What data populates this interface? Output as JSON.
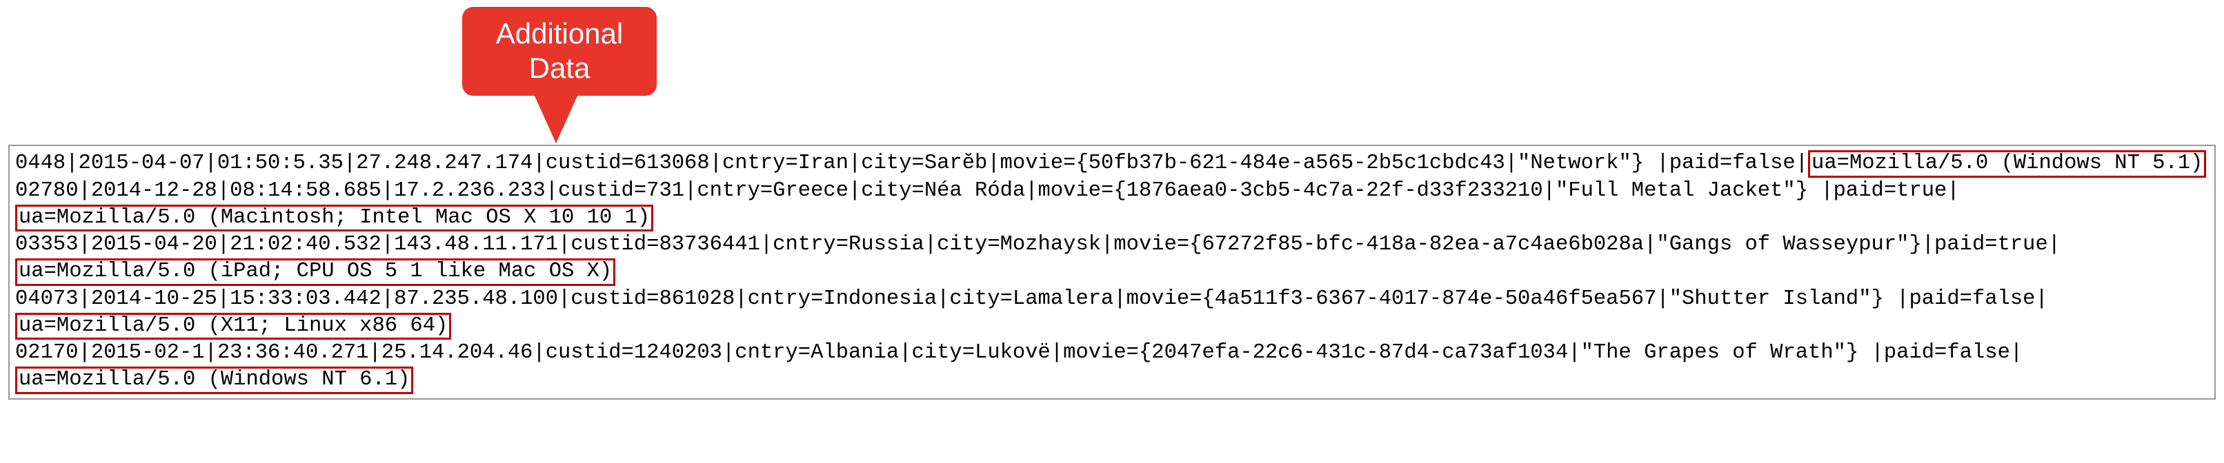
{
  "callout": {
    "line1": "Additional",
    "line2": "Data"
  },
  "log": {
    "entries": [
      {
        "prefix": "0448|2015-04-07|01:50:5.35|27.248.247.174|custid=613068|cntry=Iran|city=Sarĕb|movie={50fb37b-621-484e-a565-2b5c1cbdc43|\"Network\"} |paid=false|",
        "highlight": "ua=Mozilla/5.0 (Windows NT 5.1)"
      },
      {
        "prefix": "02780|2014-12-28|08:14:58.685|17.2.236.233|custid=731|cntry=Greece|city=Néa Róda|movie={1876aea0-3cb5-4c7a-22f-d33f233210|\"Full Metal Jacket\"} |paid=true|",
        "highlight": "ua=Mozilla/5.0 (Macintosh; Intel Mac OS X 10 10 1)"
      },
      {
        "prefix": "03353|2015-04-20|21:02:40.532|143.48.11.171|custid=83736441|cntry=Russia|city=Mozhaysk|movie={67272f85-bfc-418a-82ea-a7c4ae6b028a|\"Gangs of Wasseypur\"}|paid=true|",
        "highlight": "ua=Mozilla/5.0 (iPad; CPU OS 5 1 like Mac OS X)"
      },
      {
        "prefix": "04073|2014-10-25|15:33:03.442|87.235.48.100|custid=861028|cntry=Indonesia|city=Lamalera|movie={4a511f3-6367-4017-874e-50a46f5ea567|\"Shutter Island\"} |paid=false|",
        "highlight": "ua=Mozilla/5.0 (X11; Linux x86 64)"
      },
      {
        "prefix": "02170|2015-02-1|23:36:40.271|25.14.204.46|custid=1240203|cntry=Albania|city=Lukovë|movie={2047efa-22c6-431c-87d4-ca73af1034|\"The Grapes of Wrath\"} |paid=false|",
        "highlight": "ua=Mozilla/5.0 (Windows NT 6.1)"
      }
    ]
  }
}
